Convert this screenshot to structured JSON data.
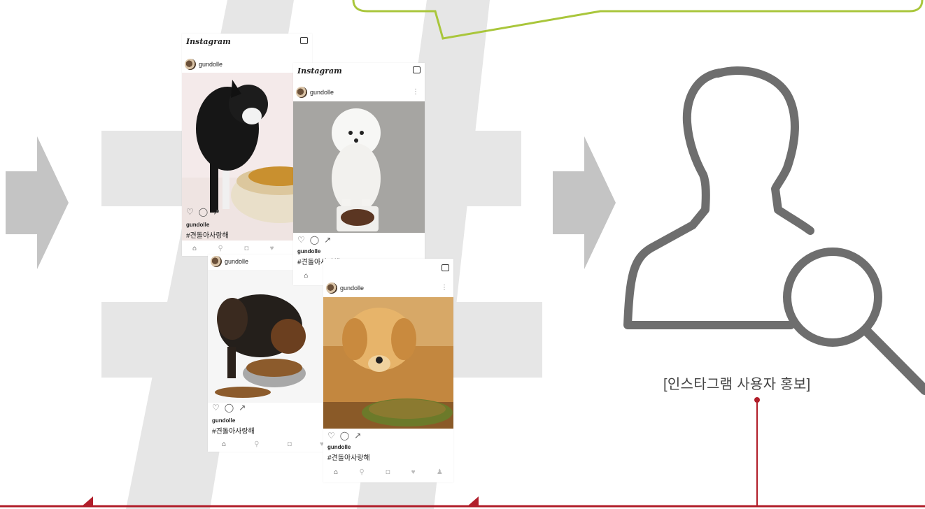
{
  "app_name": "Instagram",
  "username": "gundolle",
  "hashtag": "#견돌아사랑해",
  "caption": "[인스타그램 사용자 홍보]",
  "icons": {
    "heart": "♡",
    "comment": "◯",
    "share": "↗",
    "home": "⌂",
    "search": "⚲",
    "camera": "◘",
    "activity": "♥",
    "profile": "♟",
    "more": "⋮"
  },
  "colors": {
    "arrow_gray": "#c4c4c4",
    "hash_gray": "#e6e6e6",
    "icon_gray": "#6e6e6e",
    "green_line": "#a9c63b",
    "red_line": "#b11e2a"
  }
}
